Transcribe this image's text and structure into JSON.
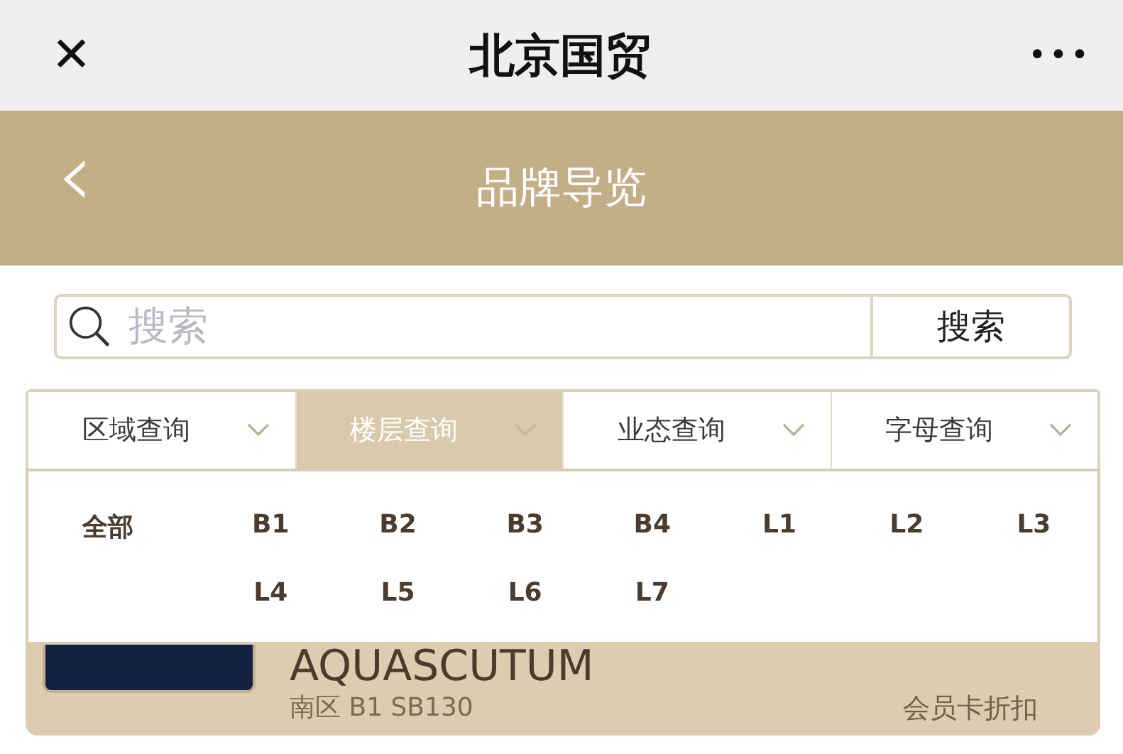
{
  "top_bar": {
    "close": "✕",
    "title": "北京国贸",
    "more": "•••"
  },
  "header": {
    "back": "‹",
    "title": "品牌导览"
  },
  "search": {
    "placeholder": "搜索",
    "button": "搜索"
  },
  "filter_tabs": [
    {
      "label": "区域查询",
      "selected": false
    },
    {
      "label": "楼层查询",
      "selected": true
    },
    {
      "label": "业态查询",
      "selected": false
    },
    {
      "label": "字母查询",
      "selected": false
    }
  ],
  "floor_menu": {
    "all": "全部",
    "levels": [
      "B1",
      "B2",
      "B3",
      "B4",
      "L1",
      "L2",
      "L3",
      "L4",
      "L5",
      "L6",
      "L7"
    ]
  },
  "brand_card": {
    "name": "AQUASCUTUM",
    "location": "南区 B1 SB130",
    "tag": "会员卡折扣"
  }
}
